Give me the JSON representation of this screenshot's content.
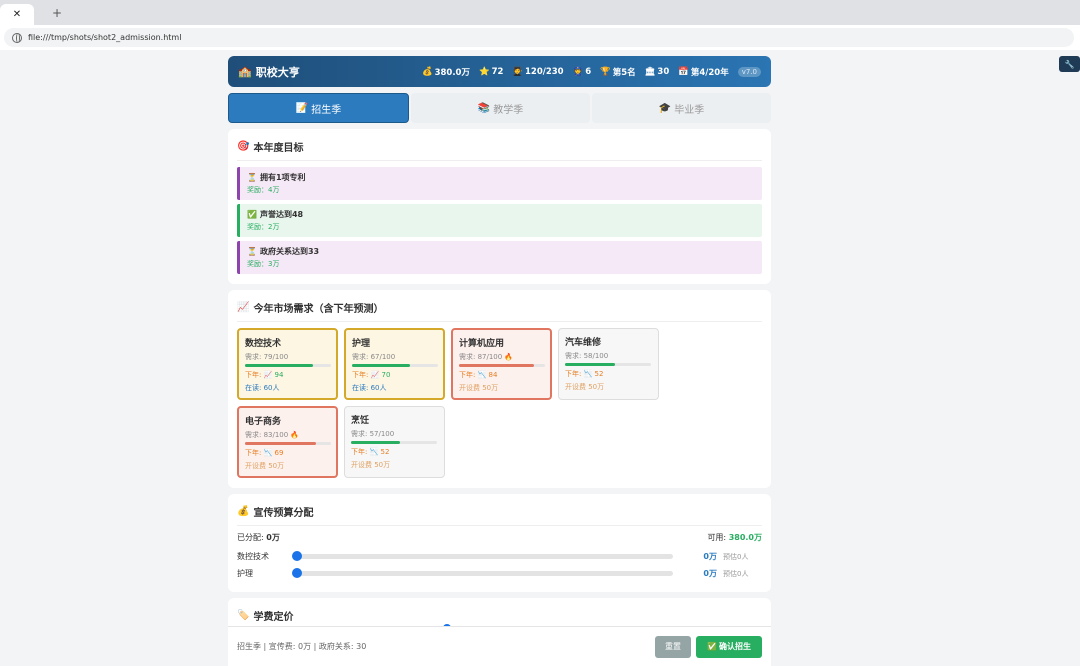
{
  "browser": {
    "tab_close": "✕",
    "new_tab": "+",
    "url": "file:///tmp/shots/shot2_admission.html",
    "tool_icon": "🔧"
  },
  "header": {
    "icon": "🏫",
    "title": "职校大亨",
    "money_icon": "💰",
    "money": "380.0万",
    "rep_icon": "⭐",
    "reputation": "72",
    "students_icon": "🧑‍🎓",
    "students": "120/230",
    "teachers_icon": "👮",
    "teachers": "6",
    "rank_icon": "🏆",
    "rank": "第5名",
    "gov_icon": "🏛",
    "gov": "30",
    "year_icon": "📅",
    "year": "第4/20年",
    "version": "v7.0"
  },
  "tabs": [
    {
      "icon": "📝",
      "label": "招生季"
    },
    {
      "icon": "📚",
      "label": "教学季"
    },
    {
      "icon": "🎓",
      "label": "毕业季"
    }
  ],
  "goals": {
    "icon": "🎯",
    "title": "本年度目标",
    "items": [
      {
        "icon": "⏳",
        "name": "拥有1项专利",
        "reward": "奖励：4万"
      },
      {
        "icon": "✅",
        "name": "声誉达到48",
        "reward": "奖励：2万"
      },
      {
        "icon": "⏳",
        "name": "政府关系达到33",
        "reward": "奖励：3万"
      }
    ]
  },
  "market": {
    "icon": "📈",
    "title": "今年市场需求（含下年预测）",
    "items": [
      {
        "name": "数控技术",
        "demand": "需求: 79/100",
        "demand_value": 79,
        "next_label": "下年:",
        "trend_icon": "📈",
        "next_value": "94",
        "foot": "在读: 60人"
      },
      {
        "name": "护理",
        "demand": "需求: 67/100",
        "demand_value": 67,
        "next_label": "下年:",
        "trend_icon": "📈",
        "next_value": "70",
        "foot": "在读: 60人"
      },
      {
        "name": "计算机应用",
        "demand": "需求: 87/100 🔥",
        "demand_value": 87,
        "next_label": "下年:",
        "trend_icon": "📉",
        "next_value": "84",
        "foot": "开设费 50万"
      },
      {
        "name": "汽车维修",
        "demand": "需求: 58/100",
        "demand_value": 58,
        "next_label": "下年:",
        "trend_icon": "📉",
        "next_value": "52",
        "foot": "开设费 50万"
      },
      {
        "name": "电子商务",
        "demand": "需求: 83/100 🔥",
        "demand_value": 83,
        "next_label": "下年:",
        "trend_icon": "📉",
        "next_value": "69",
        "foot": "开设费 50万"
      },
      {
        "name": "烹饪",
        "demand": "需求: 57/100",
        "demand_value": 57,
        "next_label": "下年:",
        "trend_icon": "📉",
        "next_value": "52",
        "foot": "开设费 50万"
      }
    ]
  },
  "budget": {
    "icon": "💰",
    "title": "宣传预算分配",
    "allocated_label": "已分配:",
    "allocated": "0万",
    "available_label": "可用:",
    "available": "380.0万",
    "rows": [
      {
        "label": "数控技术",
        "value": "0万",
        "estimate": "预估0人"
      },
      {
        "label": "护理",
        "value": "0万",
        "estimate": "预估0人"
      }
    ]
  },
  "tuition": {
    "icon": "🏷️",
    "title": "学费定价"
  },
  "footer": {
    "status": "招生季 | 宣传费: 0万 | 政府关系: 30",
    "reset": "重置",
    "confirm_icon": "✅",
    "confirm": "确认招生"
  }
}
